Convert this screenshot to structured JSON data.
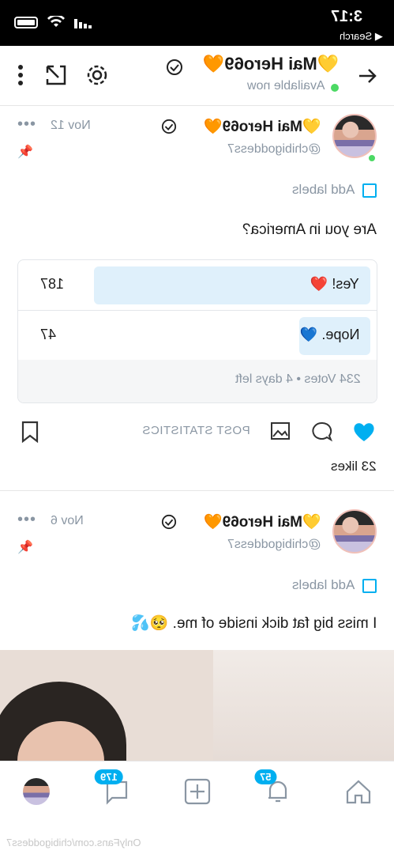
{
  "status_bar": {
    "time": "3:17",
    "back_label": "◀ Search"
  },
  "header": {
    "title": "💛Mai Hero69🧡",
    "subtitle": "Available now"
  },
  "posts": [
    {
      "name": "💛Mai Hero69🧡",
      "handle": "@chibigoddess7",
      "date": "Nov 12",
      "labels": "Add labels",
      "text": "Are you in America?",
      "poll": {
        "options": [
          {
            "label": "Yes! ❤️",
            "votes": "187",
            "fraction": 0.8
          },
          {
            "label": "Nope. 💙",
            "votes": "47",
            "fraction": 0.2
          }
        ],
        "summary": "234 Votes • 4 days left"
      },
      "stats_label": "POST STATISTICS",
      "likes": "23 likes"
    },
    {
      "name": "💛Mai Hero69🧡",
      "handle": "@chibigoddess7",
      "date": "Nov 6",
      "labels": "Add labels",
      "text": "I miss big fat dick inside of me. 🥺💦"
    }
  ],
  "nav": {
    "messages_badge": "179",
    "notifications_badge": "57"
  },
  "watermark": "OnlyFans.com/chibigoddess7",
  "colors": {
    "accent": "#00aff0",
    "online": "#4cd964",
    "muted": "#8a96a3",
    "heart": "#00aff0"
  }
}
